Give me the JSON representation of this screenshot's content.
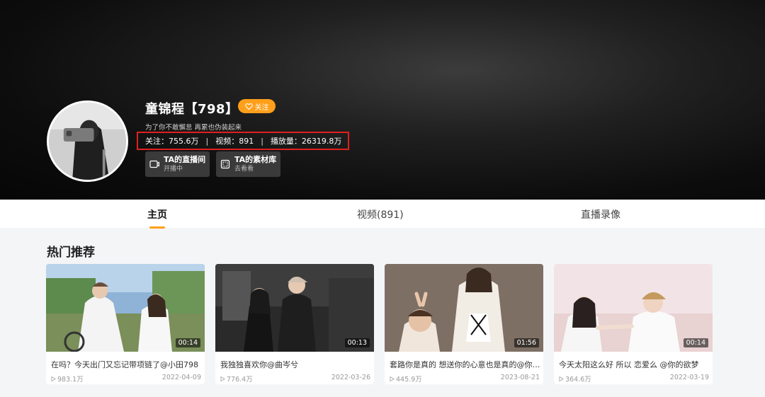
{
  "profile": {
    "name": "童锦程【798】",
    "follow_label": "关注",
    "bio": "为了你不敢懈怠 再累也伪装起来",
    "stats": {
      "following": "关注：755.6万",
      "videos": "视频：891",
      "plays": "播放量：26319.8万",
      "separator": "|"
    },
    "live_room": {
      "title": "TA的直播间",
      "subtitle": "开播中"
    },
    "material_library": {
      "title": "TA的素材库",
      "subtitle": "去看看"
    }
  },
  "tabs": [
    {
      "label": "主页",
      "active": true
    },
    {
      "label": "视频(891)",
      "active": false
    },
    {
      "label": "直播录像",
      "active": false
    }
  ],
  "section": {
    "title": "热门推荐"
  },
  "videos": [
    {
      "title": "在吗？今天出门又忘记带项链了@小田798",
      "duration": "00:14",
      "plays": "983.1万",
      "date": "2022-04-09"
    },
    {
      "title": "我独独喜欢你@曲岑兮",
      "duration": "00:13",
      "plays": "776.4万",
      "date": "2022-03-26"
    },
    {
      "title": "套路你是真的 想送你的心意也是真的@你…",
      "duration": "01:56",
      "plays": "445.9万",
      "date": "2023-08-21"
    },
    {
      "title": "今天太阳这么好 所以 恋爱么 @你的欲梦",
      "duration": "00:14",
      "plays": "364.6万",
      "date": "2022-03-19"
    }
  ],
  "colors": {
    "accent": "#ff9f1a",
    "highlight_box": "#e02020",
    "header_bg": "#0d0d0d",
    "page_bg": "#f4f5f7"
  },
  "icons": {
    "follow": "heart-plus-icon",
    "live_room": "tv-icon",
    "material": "library-icon",
    "play_count": "play-triangle-icon"
  }
}
